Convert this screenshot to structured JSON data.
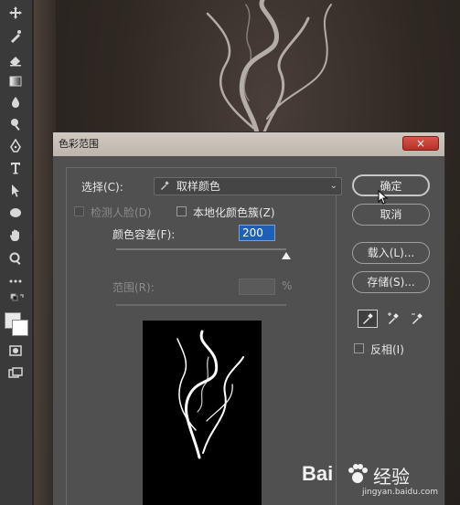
{
  "dialog": {
    "title": "色彩范围",
    "close_label": "×",
    "select_label": "选择(C):",
    "select_value": "取样颜色",
    "detect_faces_label": "检测人脸(D)",
    "localized_label": "本地化颜色簇(Z)",
    "fuzziness_label": "颜色容差(F):",
    "fuzziness_value": "200",
    "range_label": "范围(R):",
    "range_unit": "%",
    "invert_label": "反相(I)",
    "buttons": {
      "ok": "确定",
      "cancel": "取消",
      "load": "载入(L)...",
      "save": "存储(S)..."
    }
  },
  "icons": {
    "eyedropper": "eyedropper-icon",
    "eyedropper_plus": "eyedropper-plus-icon",
    "eyedropper_minus": "eyedropper-minus-icon"
  },
  "watermark": {
    "brand": "Bai",
    "brand2": "经验",
    "url": "jingyan.baidu.com"
  },
  "colors": {
    "accent": "#1e5fb8",
    "close": "#c0392b"
  },
  "fuzziness_slider_fraction": 1.0
}
